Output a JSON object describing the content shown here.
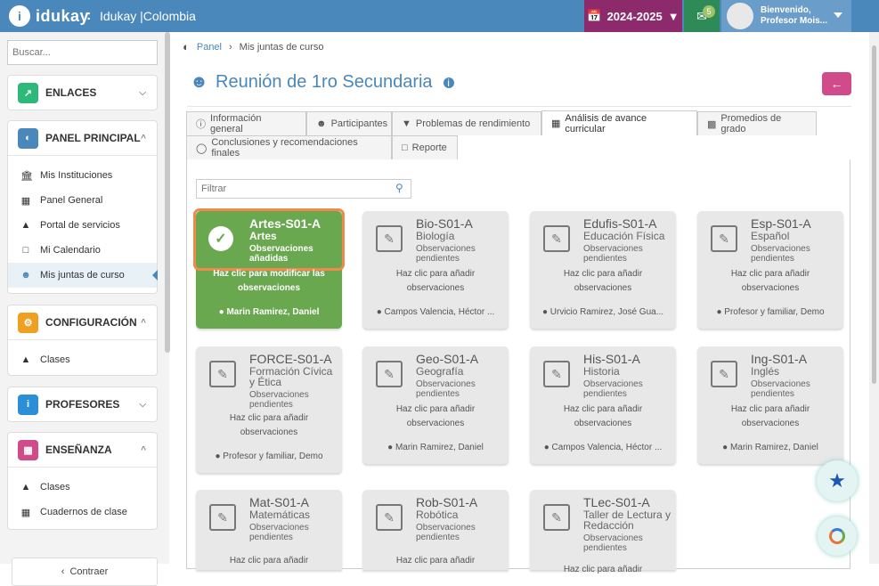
{
  "app": {
    "logo_letter": "i",
    "brand": "idukay",
    "org": "Idukay |Colombia",
    "year": "2024-2025",
    "mail_count": "5",
    "greeting": "Bienvenido,",
    "user_name": "Profesor Mois..."
  },
  "sidebar": {
    "search_placeholder": "Buscar...",
    "sections": [
      {
        "label": "ENLACES",
        "color": "#2eb87a",
        "icon": "link-icon",
        "items": []
      },
      {
        "label": "PANEL PRINCIPAL",
        "color": "#4a87ba",
        "icon": "dashboard-icon",
        "items": [
          "Mis Instituciones",
          "Panel General",
          "Portal de servicios",
          "Mi Calendario",
          "Mis juntas de curso"
        ]
      },
      {
        "label": "CONFIGURACIÓN",
        "color": "#f0a020",
        "icon": "cogs-icon",
        "items": [
          "Clases"
        ]
      },
      {
        "label": "PROFESORES",
        "color": "#2a8fd6",
        "icon": "id-card-icon",
        "items": []
      },
      {
        "label": "ENSEÑANZA",
        "color": "#d14b8a",
        "icon": "book-icon",
        "items": [
          "Clases",
          "Cuadernos de clase"
        ]
      }
    ],
    "collapse": "Contraer"
  },
  "main": {
    "breadcrumb": [
      "Panel",
      "Mis juntas de curso"
    ],
    "title": "Reunión de 1ro Secundaria",
    "tabs": [
      "Información general",
      "Participantes",
      "Problemas de rendimiento",
      "Análisis de avance curricular",
      "Promedios de grado",
      "Conclusiones y recomendaciones finales",
      "Reporte"
    ],
    "filter_placeholder": "Filtrar",
    "cards": [
      {
        "code": "Artes-S01-A",
        "subject": "Artes",
        "status": "Observaciones añadidas",
        "hint": "Haz clic para modificar las observaciones",
        "teacher": "Marin Ramirez, Daniel",
        "done": true
      },
      {
        "code": "Bio-S01-A",
        "subject": "Biología",
        "status": "Observaciones pendientes",
        "hint": "Haz clic para añadir observaciones",
        "teacher": "Campos Valencia, Héctor ..."
      },
      {
        "code": "Edufis-S01-A",
        "subject": "Educación Física",
        "status": "Observaciones pendientes",
        "hint": "Haz clic para añadir observaciones",
        "teacher": "Urvicio Ramirez, José Gua..."
      },
      {
        "code": "Esp-S01-A",
        "subject": "Español",
        "status": "Observaciones pendientes",
        "hint": "Haz clic para añadir observaciones",
        "teacher": "Profesor y familiar, Demo"
      },
      {
        "code": "FORCE-S01-A",
        "subject": "Formación Cívica y Ética",
        "status": "Observaciones pendientes",
        "hint": "Haz clic para añadir observaciones",
        "teacher": "Profesor y familiar, Demo"
      },
      {
        "code": "Geo-S01-A",
        "subject": "Geografía",
        "status": "Observaciones pendientes",
        "hint": "Haz clic para añadir observaciones",
        "teacher": "Marin Ramirez, Daniel"
      },
      {
        "code": "His-S01-A",
        "subject": "Historia",
        "status": "Observaciones pendientes",
        "hint": "Haz clic para añadir observaciones",
        "teacher": "Campos Valencia, Héctor ..."
      },
      {
        "code": "Ing-S01-A",
        "subject": "Inglés",
        "status": "Observaciones pendientes",
        "hint": "Haz clic para añadir observaciones",
        "teacher": "Marin Ramirez, Daniel"
      },
      {
        "code": "Mat-S01-A",
        "subject": "Matemáticas",
        "status": "Observaciones pendientes",
        "hint": "Haz clic para añadir",
        "teacher": ""
      },
      {
        "code": "Rob-S01-A",
        "subject": "Robótica",
        "status": "Observaciones pendientes",
        "hint": "Haz clic para añadir",
        "teacher": ""
      },
      {
        "code": "TLec-S01-A",
        "subject": "Taller de Lectura y Redacción",
        "status": "Observaciones pendientes",
        "hint": "Haz clic para añadir",
        "teacher": ""
      }
    ]
  }
}
